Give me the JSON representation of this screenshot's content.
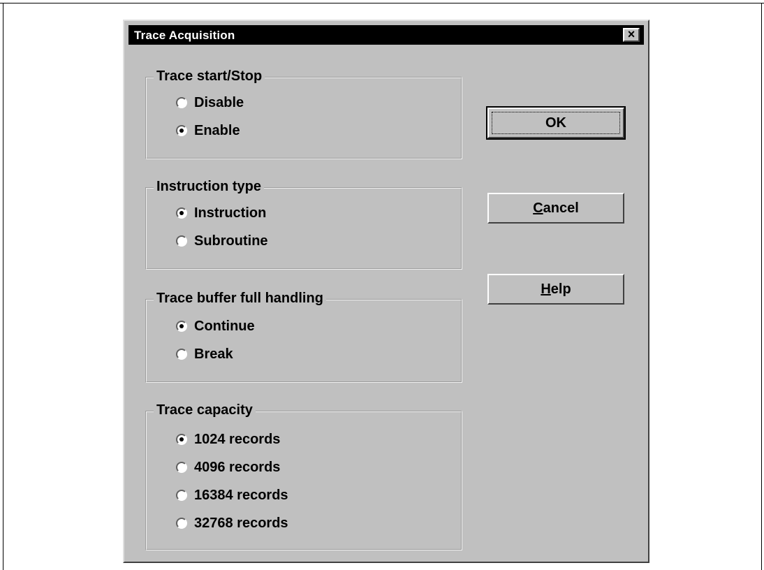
{
  "dialog": {
    "title": "Trace Acquisition",
    "close_glyph": "×"
  },
  "groups": [
    {
      "label": "Trace start/Stop",
      "options": [
        {
          "label": "Disable",
          "checked": false
        },
        {
          "label": "Enable",
          "checked": true
        }
      ]
    },
    {
      "label": "Instruction type",
      "options": [
        {
          "label": "Instruction",
          "checked": true
        },
        {
          "label": "Subroutine",
          "checked": false
        }
      ]
    },
    {
      "label": "Trace buffer full handling",
      "options": [
        {
          "label": "Continue",
          "checked": true
        },
        {
          "label": "Break",
          "checked": false
        }
      ]
    },
    {
      "label": "Trace capacity",
      "options": [
        {
          "label": "1024 records",
          "checked": true
        },
        {
          "label": "4096 records",
          "checked": false
        },
        {
          "label": "16384 records",
          "checked": false
        },
        {
          "label": "32768 records",
          "checked": false
        }
      ]
    }
  ],
  "buttons": {
    "ok": {
      "label": "OK"
    },
    "cancel": {
      "label_mnemonic": "C",
      "label_rest": "ancel"
    },
    "help": {
      "label_mnemonic": "H",
      "label_rest": "elp"
    }
  }
}
